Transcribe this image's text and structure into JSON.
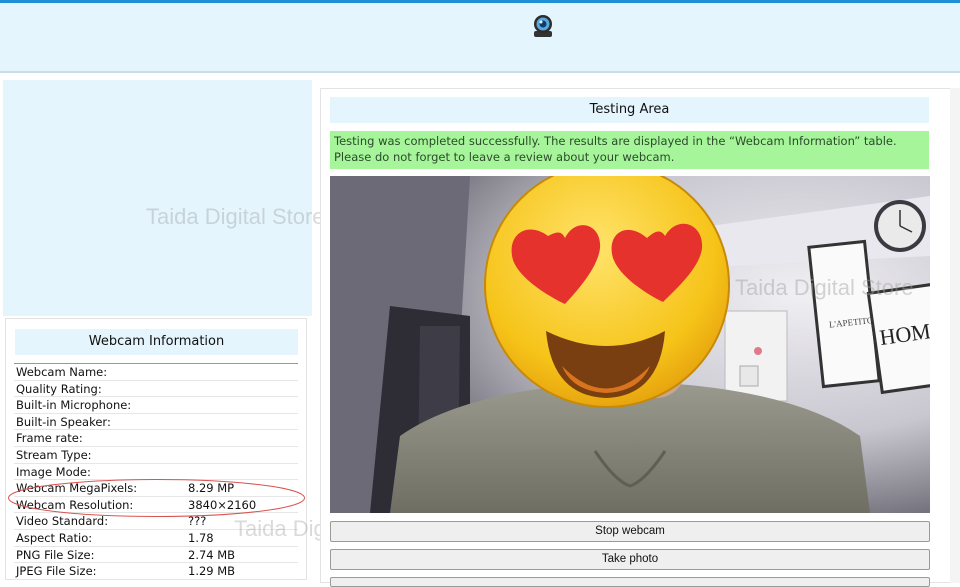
{
  "header": {
    "logo_icon": "webcam-icon",
    "accent_color": "#1e90d6",
    "background": "#e4f5fd"
  },
  "watermark": {
    "text": "Taida Digital Store"
  },
  "info_panel": {
    "title": "Webcam Information",
    "rows": [
      {
        "key": "Webcam Name:",
        "value": ""
      },
      {
        "key": "Quality Rating:",
        "value": ""
      },
      {
        "key": "Built-in Microphone:",
        "value": ""
      },
      {
        "key": "Built-in Speaker:",
        "value": ""
      },
      {
        "key": "Frame rate:",
        "value": ""
      },
      {
        "key": "Stream Type:",
        "value": ""
      },
      {
        "key": "Image Mode:",
        "value": ""
      },
      {
        "key": "Webcam MegaPixels:",
        "value": "8.29 MP"
      },
      {
        "key": "Webcam Resolution:",
        "value": "3840×2160"
      },
      {
        "key": "Video Standard:",
        "value": "???"
      },
      {
        "key": "Aspect Ratio:",
        "value": "1.78"
      },
      {
        "key": "PNG File Size:",
        "value": "2.74 MB"
      },
      {
        "key": "JPEG File Size:",
        "value": "1.29 MB"
      }
    ]
  },
  "test_panel": {
    "title": "Testing Area",
    "message": "Testing was completed successfully. The results are displayed in the “Webcam Information” table. Please do not forget to leave a review about your webcam.",
    "success_color": "#a6f59a",
    "buttons": {
      "stop": "Stop webcam",
      "photo": "Take photo"
    },
    "video_overlay": {
      "emoji_icon": "heart-eyes-emoji-icon",
      "poster_text": "HOM"
    }
  }
}
